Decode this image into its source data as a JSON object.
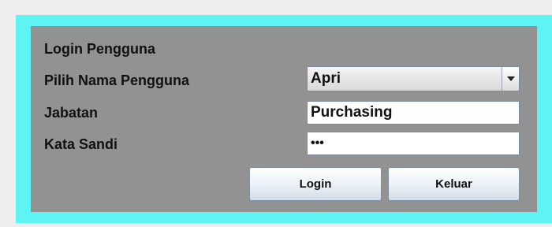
{
  "form": {
    "title": "Login Pengguna",
    "user_label": "Pilih Nama Pengguna",
    "user_value": "Apri",
    "position_label": "Jabatan",
    "position_value": "Purchasing",
    "password_label": "Kata Sandi",
    "password_value": "•••",
    "login_label": "Login",
    "exit_label": "Keluar"
  },
  "colors": {
    "background": "#eeeeee",
    "frame": "#5ff4f4",
    "panel": "#929292"
  },
  "icons": {
    "combo_arrow": "chevron-down-icon"
  }
}
